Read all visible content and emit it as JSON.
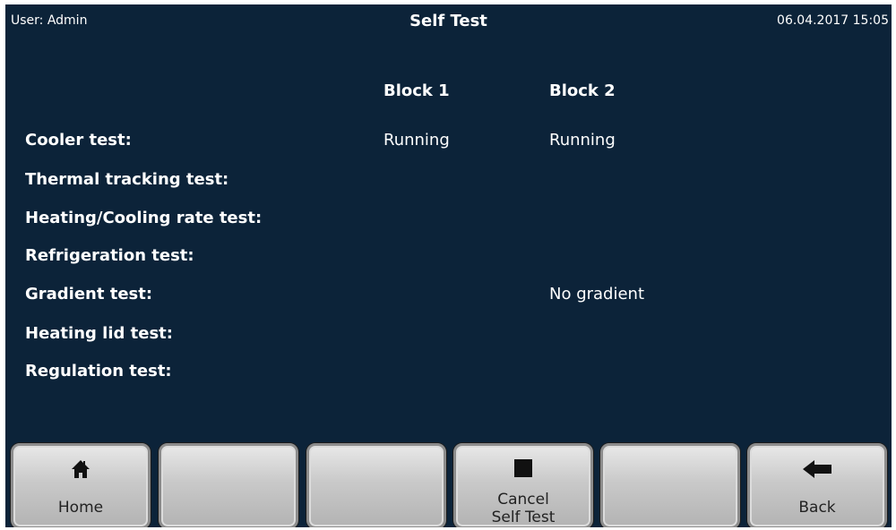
{
  "header": {
    "user": "User: Admin",
    "title": "Self Test",
    "datetime": "06.04.2017 15:05"
  },
  "columns": {
    "block1": "Block 1",
    "block2": "Block 2"
  },
  "rows": [
    {
      "label": "Cooler test:",
      "block1": "Running",
      "block2": "Running"
    },
    {
      "label": "Thermal tracking test:",
      "block1": "",
      "block2": ""
    },
    {
      "label": "Heating/Cooling rate test:",
      "block1": "",
      "block2": ""
    },
    {
      "label": "Refrigeration test:",
      "block1": "",
      "block2": ""
    },
    {
      "label": "Gradient test:",
      "block1": "",
      "block2": "No gradient"
    },
    {
      "label": "Heating lid test:",
      "block1": "",
      "block2": ""
    },
    {
      "label": "Regulation test:",
      "block1": "",
      "block2": ""
    }
  ],
  "buttons": [
    {
      "label": "Home",
      "icon": "home-icon"
    },
    {
      "label": "",
      "icon": ""
    },
    {
      "label": "",
      "icon": ""
    },
    {
      "label": "Cancel\nSelf Test",
      "icon": "stop-icon"
    },
    {
      "label": "",
      "icon": ""
    },
    {
      "label": "Back",
      "icon": "back-arrow-icon"
    }
  ]
}
